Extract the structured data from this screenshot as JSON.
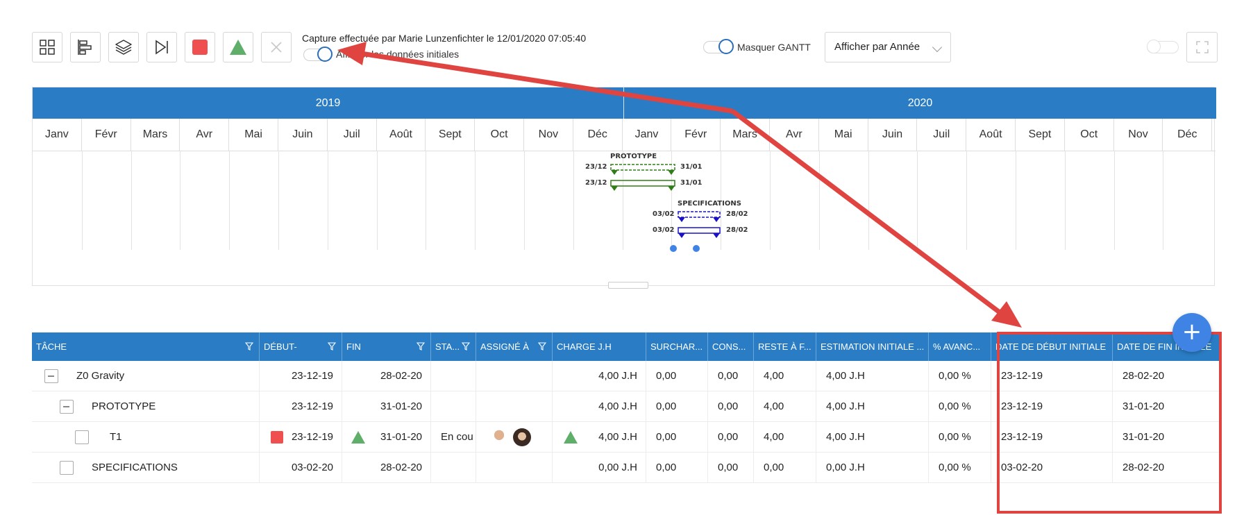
{
  "toolbar": {
    "capture_text": "Capture effectuée par Marie Lunzenfichter le 12/01/2020 07:05:40",
    "show_initial_label": "Afficher les données initiales",
    "hide_gantt_label": "Masquer GANTT",
    "display_select_value": "Afficher par Année",
    "icons": [
      "grid-icon",
      "gantt-icon",
      "layers-icon",
      "skip-end-icon",
      "red-square-icon",
      "green-triangle-icon",
      "close-icon",
      "fullscreen-icon"
    ]
  },
  "gantt": {
    "years": [
      "2019",
      "2020"
    ],
    "months": [
      "Janv",
      "Févr",
      "Mars",
      "Avr",
      "Mai",
      "Juin",
      "Juil",
      "Août",
      "Sept",
      "Oct",
      "Nov",
      "Déc",
      "Janv",
      "Févr",
      "Mars",
      "Avr",
      "Mai",
      "Juin",
      "Juil",
      "Août",
      "Sept",
      "Oct",
      "Nov",
      "Déc"
    ],
    "tasks": [
      {
        "name": "PROTOTYPE",
        "start_label": "23/12",
        "end_label": "31/01",
        "color": "#2e7d16"
      },
      {
        "name": "SPECIFICATIONS",
        "start_label": "03/02",
        "end_label": "28/02",
        "color": "#1a10c8"
      }
    ]
  },
  "grid": {
    "columns": [
      "TÂCHE",
      "DÉBUT-",
      "FIN",
      "STA...",
      "ASSIGNÉ À",
      "CHARGE J.H",
      "SURCHAR...",
      "CONS...",
      "RESTE À F...",
      "ESTIMATION INITIALE ...",
      "% AVANC...",
      "DATE DE DÉBUT INITIALE",
      "DATE DE FIN INITIALE"
    ],
    "rows": [
      {
        "task": "Z0 Gravity",
        "debut": "23-12-19",
        "fin": "28-02-20",
        "statut": "",
        "charge": "4,00 J.H",
        "surcharge": "0,00",
        "cons": "0,00",
        "reste": "4,00",
        "estimation": "4,00 J.H",
        "avancement": "0,00 %",
        "debut_initial": "23-12-19",
        "fin_initial": "28-02-20"
      },
      {
        "task": "PROTOTYPE",
        "debut": "23-12-19",
        "fin": "31-01-20",
        "statut": "",
        "charge": "4,00 J.H",
        "surcharge": "0,00",
        "cons": "0,00",
        "reste": "4,00",
        "estimation": "4,00 J.H",
        "avancement": "0,00 %",
        "debut_initial": "23-12-19",
        "fin_initial": "31-01-20"
      },
      {
        "task": "T1",
        "debut": "23-12-19",
        "fin": "31-01-20",
        "statut": "En cou",
        "charge": "4,00 J.H",
        "surcharge": "0,00",
        "cons": "0,00",
        "reste": "4,00",
        "estimation": "4,00 J.H",
        "avancement": "0,00 %",
        "debut_initial": "23-12-19",
        "fin_initial": "31-01-20"
      },
      {
        "task": "SPECIFICATIONS",
        "debut": "03-02-20",
        "fin": "28-02-20",
        "statut": "",
        "charge": "0,00 J.H",
        "surcharge": "0,00",
        "cons": "0,00",
        "reste": "0,00",
        "estimation": "0,00 J.H",
        "avancement": "0,00 %",
        "debut_initial": "03-02-20",
        "fin_initial": "28-02-20"
      }
    ]
  },
  "colors": {
    "header_blue": "#2a7dc4",
    "accent_red": "#e04440",
    "fab_blue": "#3f84e5"
  },
  "fab_label": "+"
}
